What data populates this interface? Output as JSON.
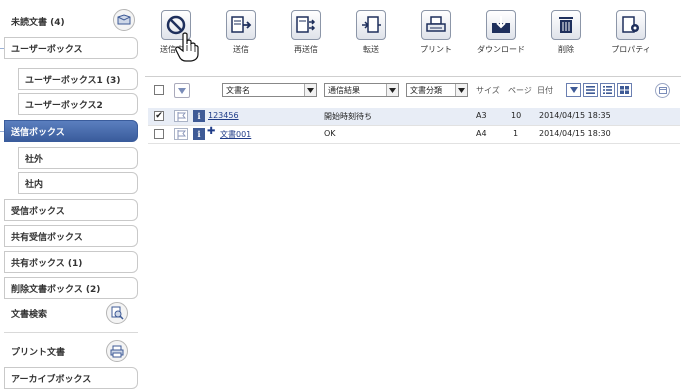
{
  "sidebar": {
    "items": [
      {
        "label": "未読文書 (4)"
      },
      {
        "label": "ユーザーボックス"
      },
      {
        "label": "ユーザーボックス1 (3)"
      },
      {
        "label": "ユーザーボックス2"
      },
      {
        "label": "送信ボックス"
      },
      {
        "label": "社外"
      },
      {
        "label": "社内"
      },
      {
        "label": "受信ボックス"
      },
      {
        "label": "共有受信ボックス"
      },
      {
        "label": "共有ボックス (1)"
      },
      {
        "label": "削除文書ボックス (2)"
      },
      {
        "label": "文書検索"
      },
      {
        "label": "プリント文書"
      },
      {
        "label": "アーカイブボックス"
      }
    ],
    "unread_icon": "unread-docs-icon",
    "search_icon": "document-search-icon",
    "print_icon": "print-documents-icon"
  },
  "toolbar": {
    "stop_label": "送信中止",
    "send_label": "送信",
    "resend_label": "再送信",
    "forward_label": "転送",
    "print_label": "プリント",
    "download_label": "ダウンロード",
    "delete_label": "削除",
    "properties_label": "プロパティ"
  },
  "list_header": {
    "doc_name": "文書名",
    "comm_result": "通信結果",
    "doc_class": "文書分類",
    "size": "サイズ",
    "pages": "ページ",
    "date": "日付"
  },
  "rows": [
    {
      "checked": true,
      "name": "123456",
      "status": "開始時刻待ち",
      "size": "A3",
      "pages": "10",
      "date": "2014/04/15 18:35",
      "has_plus": false
    },
    {
      "checked": false,
      "name": "文書001",
      "status": "OK",
      "size": "A4",
      "pages": "1",
      "date": "2014/04/15 18:30",
      "has_plus": true
    }
  ],
  "colors": {
    "accent": "#3a5c9c",
    "selected_row": "#e8edf6",
    "link": "#1f3c88"
  }
}
